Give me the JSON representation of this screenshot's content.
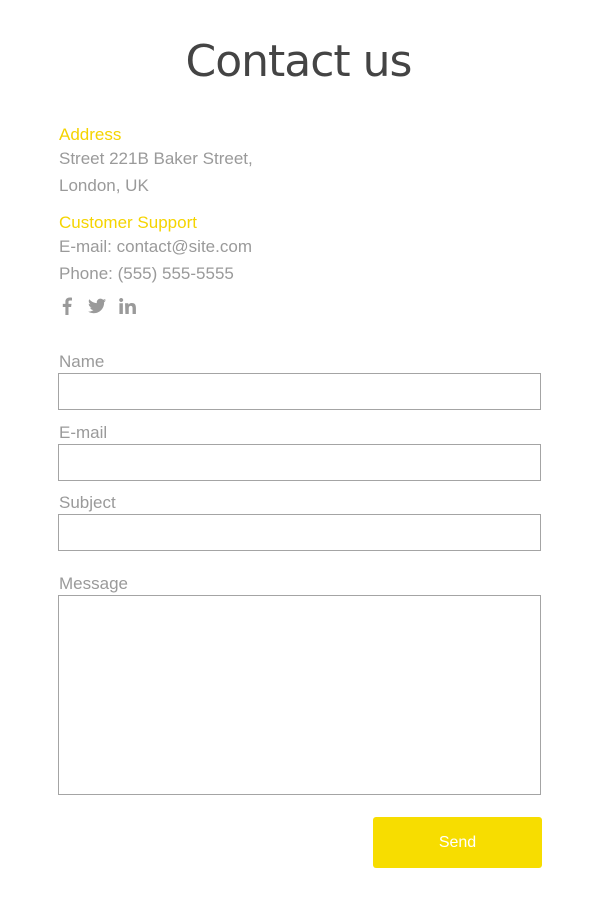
{
  "page": {
    "title": "Contact us"
  },
  "address": {
    "heading": "Address",
    "line1": "Street 221B Baker Street,",
    "line2": "London, UK"
  },
  "support": {
    "heading": "Customer Support",
    "email": "E-mail: contact@site.com",
    "phone": "Phone: (555) 555-5555"
  },
  "social": [
    "facebook-icon",
    "twitter-icon",
    "linkedin-icon"
  ],
  "form": {
    "name_label": "Name",
    "email_label": "E-mail",
    "subject_label": "Subject",
    "message_label": "Message",
    "send_label": "Send"
  },
  "colors": {
    "accent": "#f7dd00",
    "heading_accent": "#f5d400",
    "muted": "#9a9a9a",
    "title": "#444444"
  }
}
